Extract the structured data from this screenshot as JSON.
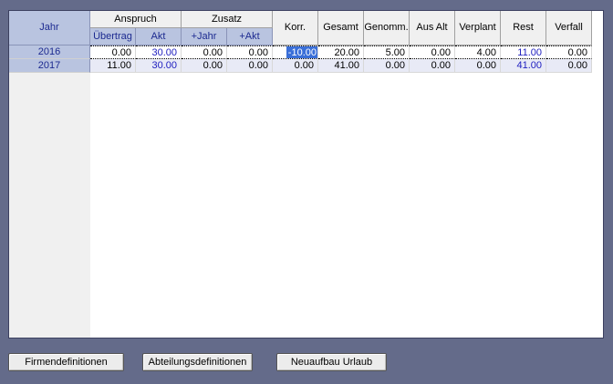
{
  "table": {
    "headers": {
      "jahr": "Jahr",
      "anspruch": "Anspruch",
      "uebertrag": "Übertrag",
      "akt": "Akt",
      "zusatz": "Zusatz",
      "plus_jahr": "+Jahr",
      "plus_akt": "+Akt",
      "korr": "Korr.",
      "gesamt": "Gesamt",
      "genomm": "Genomm.",
      "aus_alt": "Aus Alt",
      "verplant": "Verplant",
      "rest": "Rest",
      "verfall": "Verfall"
    },
    "rows": [
      {
        "jahr": "2016",
        "uebertrag": "0.00",
        "akt": "30.00",
        "plus_jahr": "0.00",
        "plus_akt": "0.00",
        "korr": "-10.00",
        "gesamt": "20.00",
        "genomm": "5.00",
        "aus_alt": "0.00",
        "verplant": "4.00",
        "rest": "11.00",
        "verfall": "0.00"
      },
      {
        "jahr": "2017",
        "uebertrag": "11.00",
        "akt": "30.00",
        "plus_jahr": "0.00",
        "plus_akt": "0.00",
        "korr": "0.00",
        "gesamt": "41.00",
        "genomm": "0.00",
        "aus_alt": "0.00",
        "verplant": "0.00",
        "rest": "41.00",
        "verfall": "0.00"
      }
    ]
  },
  "buttons": {
    "firmen": "Firmendefinitionen",
    "abteilung": "Abteilungsdefinitionen",
    "neuaufbau": "Neuaufbau Urlaub"
  },
  "colors": {
    "background": "#646b8a",
    "header_blue": "#b9c4e0",
    "value_blue": "#2020c0",
    "selection": "#3a6fd8"
  }
}
